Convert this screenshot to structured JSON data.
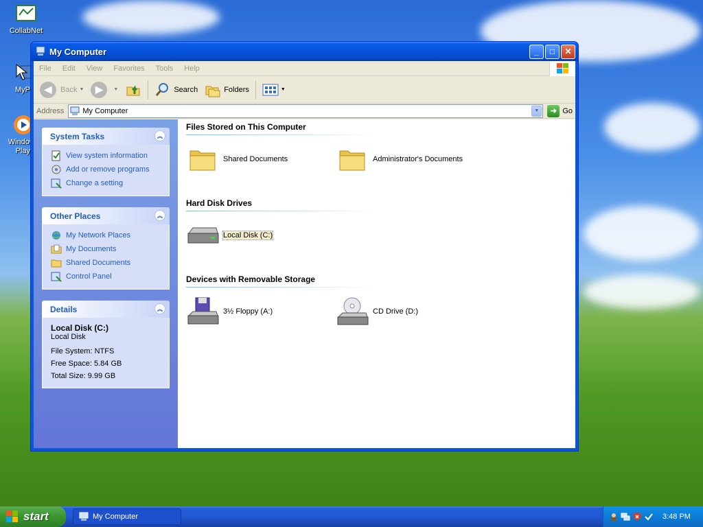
{
  "desktop": {
    "icons": [
      {
        "label": "CollabNet",
        "icon": "collabnet-icon"
      },
      {
        "label": "MyP",
        "icon": "my-programs-icon"
      },
      {
        "label": "Windows Play",
        "line1": "Windows",
        "line2": "Play",
        "icon": "media-player-icon"
      }
    ]
  },
  "window": {
    "title": "My Computer",
    "menu": [
      "File",
      "Edit",
      "View",
      "Favorites",
      "Tools",
      "Help"
    ],
    "toolbar": {
      "back": "Back",
      "search": "Search",
      "folders": "Folders"
    },
    "address": {
      "label": "Address",
      "value": "My Computer",
      "go": "Go"
    }
  },
  "taskpane": {
    "system_tasks": {
      "title": "System Tasks",
      "links": [
        "View system information",
        "Add or remove programs",
        "Change a setting"
      ]
    },
    "other_places": {
      "title": "Other Places",
      "links": [
        "My Network Places",
        "My Documents",
        "Shared Documents",
        "Control Panel"
      ]
    },
    "details": {
      "title": "Details",
      "name": "Local Disk (C:)",
      "type": "Local Disk",
      "file_system": "File System: NTFS",
      "free_space": "Free Space: 5.84 GB",
      "total_size": "Total Size: 9.99 GB"
    }
  },
  "content": {
    "groups": [
      {
        "title": "Files Stored on This Computer",
        "items": [
          "Shared Documents",
          "Administrator's Documents"
        ]
      },
      {
        "title": "Hard Disk Drives",
        "items": [
          "Local Disk (C:)"
        ]
      },
      {
        "title": "Devices with Removable Storage",
        "items": [
          "3½ Floppy (A:)",
          "CD Drive (D:)"
        ]
      }
    ]
  },
  "taskbar": {
    "start": "start",
    "task": "My Computer",
    "clock": "3:48 PM"
  },
  "colors": {
    "accent": "#215dc6",
    "title_blue": "#0452d8",
    "start_green": "#3c9a32"
  }
}
